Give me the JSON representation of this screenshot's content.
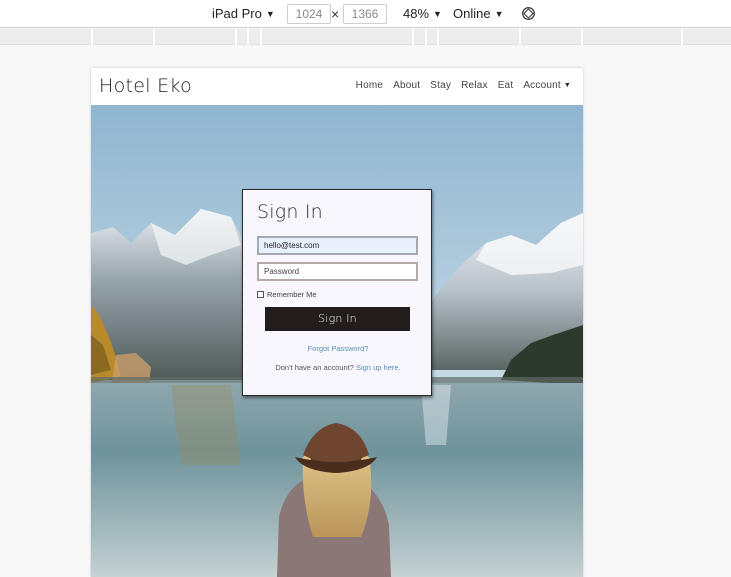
{
  "devtools": {
    "device": "iPad Pro",
    "width": "1024",
    "height": "1366",
    "times": "×",
    "zoom": "48%",
    "throttle": "Online",
    "caret": "▼"
  },
  "site": {
    "brand": "Hotel Eko",
    "nav": [
      {
        "label": "Home"
      },
      {
        "label": "About"
      },
      {
        "label": "Stay"
      },
      {
        "label": "Relax"
      },
      {
        "label": "Eat"
      },
      {
        "label": "Account"
      }
    ]
  },
  "signin": {
    "title": "Sign In",
    "email_value": "hello@test.com",
    "password_placeholder": "Password",
    "remember_label": "Remember Me",
    "button_label": "Sign In",
    "forgot_label": "Forgot Password?",
    "no_account_text": "Don't have an account?",
    "signup_label": "Sign up here."
  },
  "colors": {
    "button_bg": "#231c1c",
    "link": "#5a8fb4",
    "card_bg": "#f7f7fd"
  }
}
